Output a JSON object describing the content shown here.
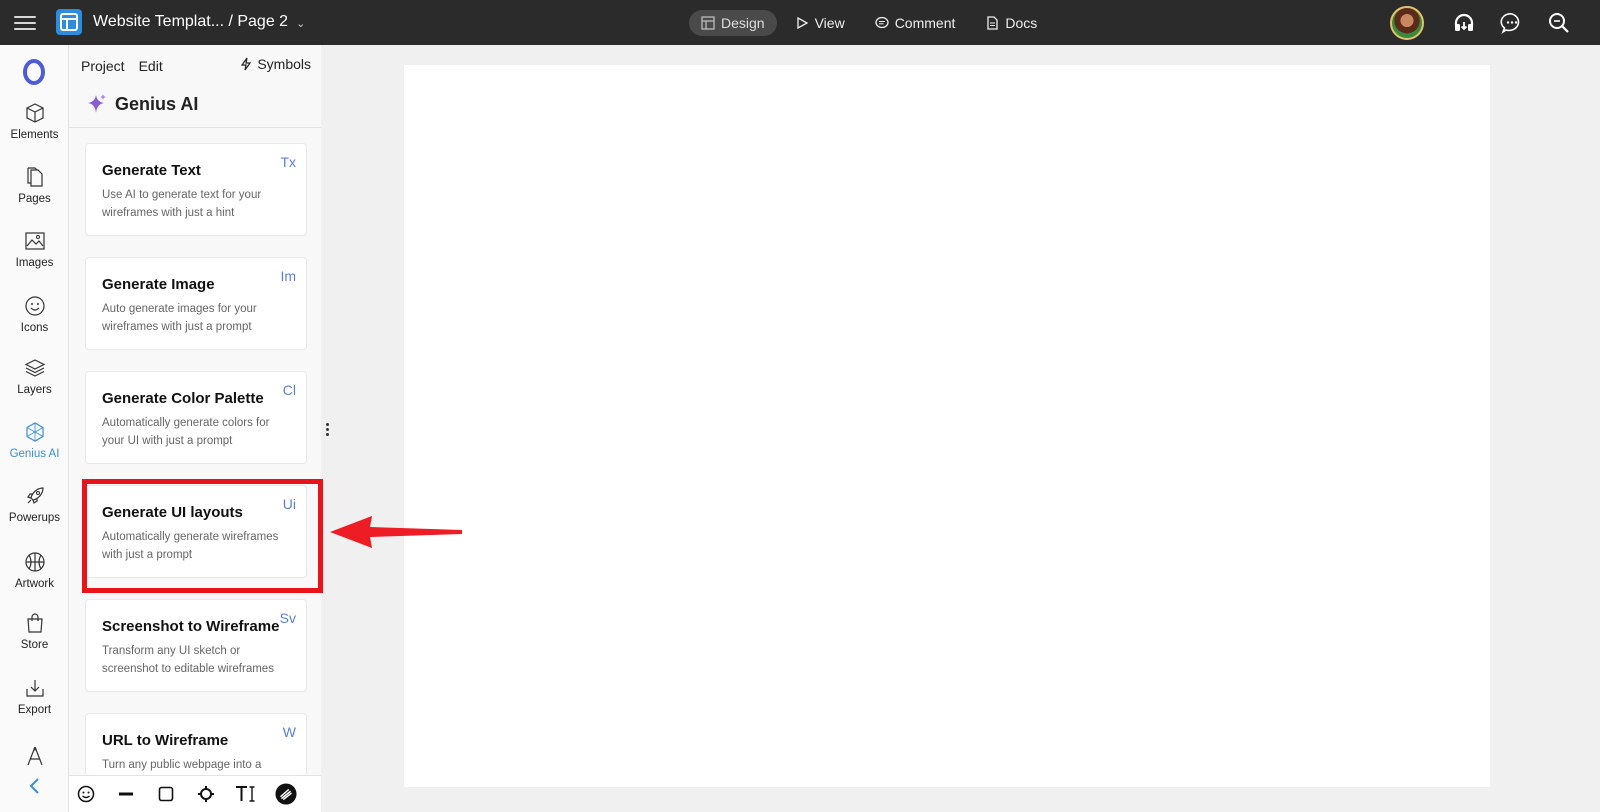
{
  "header": {
    "doc_title": "Website Templat... / Page 2",
    "modes": [
      {
        "label": "Design",
        "active": true
      },
      {
        "label": "View"
      },
      {
        "label": "Comment"
      },
      {
        "label": "Docs"
      }
    ]
  },
  "panel": {
    "tabs": [
      "Project",
      "Edit"
    ],
    "symbols_label": "Symbols",
    "section_title": "Genius AI",
    "cards": [
      {
        "title": "Generate Text",
        "description": "Use AI to generate text for your wireframes with just a hint",
        "abbr": "Tx"
      },
      {
        "title": "Generate Image",
        "description": "Auto generate images for your wireframes with just a prompt",
        "abbr": "Im"
      },
      {
        "title": "Generate Color Palette",
        "description": "Automatically generate colors for your UI with just a prompt",
        "abbr": "Cl"
      },
      {
        "title": "Generate UI layouts",
        "description": "Automatically generate wireframes with just a prompt",
        "abbr": "Ui"
      },
      {
        "title": "Screenshot to Wireframe",
        "description": "Transform any UI sketch or screenshot to editable wireframes",
        "abbr": "Sv"
      },
      {
        "title": "URL to Wireframe",
        "description": "Turn any public webpage into a",
        "abbr": "W"
      }
    ]
  },
  "sidebar": {
    "items": [
      {
        "label": "Elements",
        "icon": "cube-icon"
      },
      {
        "label": "Pages",
        "icon": "pages-icon"
      },
      {
        "label": "Images",
        "icon": "image-icon"
      },
      {
        "label": "Icons",
        "icon": "smiley-icon"
      },
      {
        "label": "Layers",
        "icon": "layers-icon"
      },
      {
        "label": "Genius AI",
        "icon": "genius-ai-icon",
        "active": true
      },
      {
        "label": "Powerups",
        "icon": "rocket-icon"
      },
      {
        "label": "Artwork",
        "icon": "basketball-icon"
      },
      {
        "label": "Store",
        "icon": "bag-icon"
      },
      {
        "label": "Export",
        "icon": "export-icon"
      }
    ]
  },
  "colors": {
    "topbar": "#2b2b2b",
    "accent": "#3a8fd6",
    "highlight": "#e8141a"
  }
}
